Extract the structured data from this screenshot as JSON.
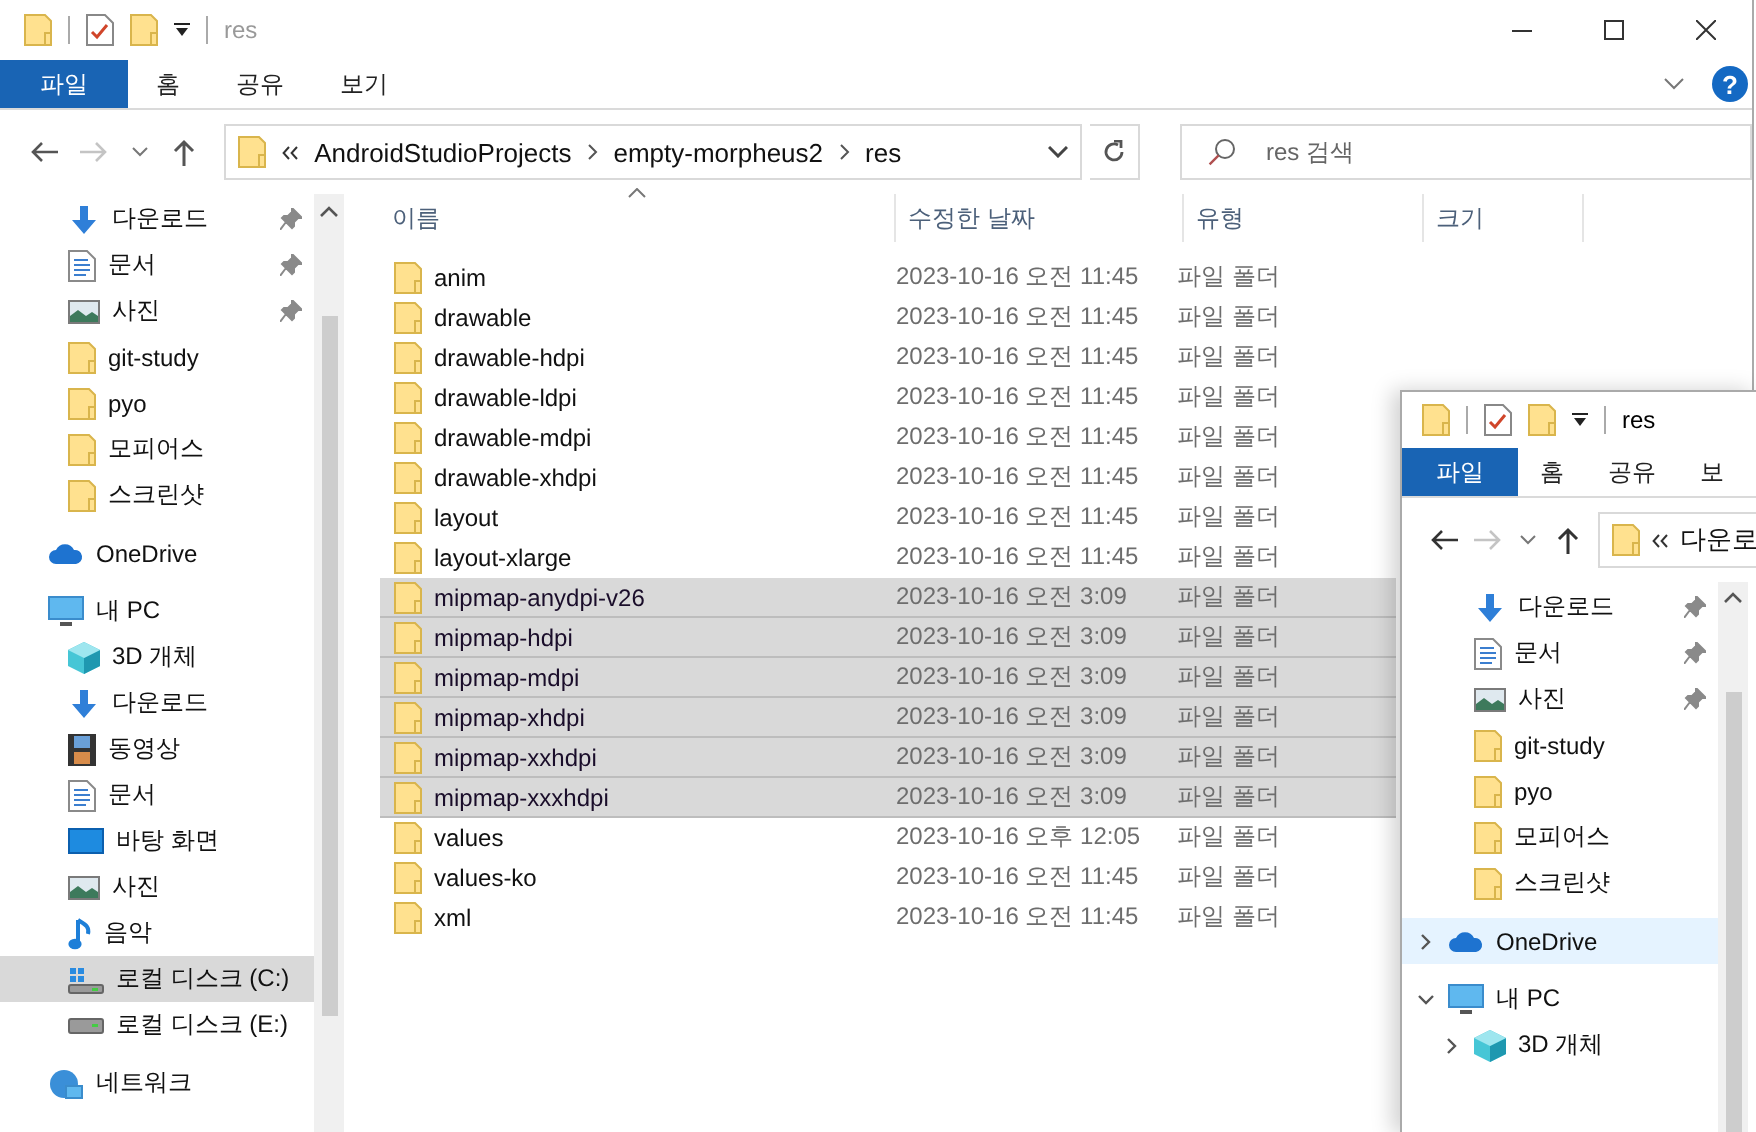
{
  "main_window": {
    "title": "res",
    "active": false,
    "help_glyph": "?",
    "ribbon_tabs": [
      {
        "label": "파일",
        "selected": true
      },
      {
        "label": "홈",
        "selected": false
      },
      {
        "label": "공유",
        "selected": false
      },
      {
        "label": "보기",
        "selected": false
      }
    ],
    "address": {
      "crumbs": [
        "AndroidStudioProjects",
        "empty-morpheus2",
        "res"
      ]
    },
    "search": {
      "placeholder": "res 검색"
    },
    "quick_access": [
      {
        "label": "다운로드",
        "kind": "download",
        "pinned": true,
        "selected": false
      },
      {
        "label": "문서",
        "kind": "document",
        "pinned": true,
        "selected": false
      },
      {
        "label": "사진",
        "kind": "picture",
        "pinned": true,
        "selected": false
      },
      {
        "label": "git-study",
        "kind": "folder",
        "pinned": false,
        "selected": false
      },
      {
        "label": "pyo",
        "kind": "folder",
        "pinned": false,
        "selected": false
      },
      {
        "label": "모피어스",
        "kind": "folder",
        "pinned": false,
        "selected": false
      },
      {
        "label": "스크린샷",
        "kind": "folder",
        "pinned": false,
        "selected": false
      }
    ],
    "tree": [
      {
        "label": "OneDrive",
        "kind": "cloud",
        "selected": false
      },
      {
        "label": "내 PC",
        "kind": "pc",
        "selected": false,
        "children": [
          {
            "label": "3D 개체",
            "kind": "cube",
            "selected": false
          },
          {
            "label": "다운로드",
            "kind": "download",
            "selected": false
          },
          {
            "label": "동영상",
            "kind": "video",
            "selected": false
          },
          {
            "label": "문서",
            "kind": "document",
            "selected": false
          },
          {
            "label": "바탕 화면",
            "kind": "desktop",
            "selected": false
          },
          {
            "label": "사진",
            "kind": "picture",
            "selected": false
          },
          {
            "label": "음악",
            "kind": "music",
            "selected": false
          },
          {
            "label": "로컬 디스크 (C:)",
            "kind": "system-drive",
            "selected": true
          },
          {
            "label": "로컬 디스크 (E:)",
            "kind": "drive",
            "selected": false
          }
        ]
      },
      {
        "label": "네트워크",
        "kind": "network",
        "selected": false
      }
    ],
    "table": {
      "columns": [
        "이름",
        "수정한 날짜",
        "유형",
        "크기"
      ],
      "rows": [
        {
          "name": "anim",
          "modified": "2023-10-16 오전 11:45",
          "type": "파일 폴더",
          "selected": false
        },
        {
          "name": "drawable",
          "modified": "2023-10-16 오전 11:45",
          "type": "파일 폴더",
          "selected": false
        },
        {
          "name": "drawable-hdpi",
          "modified": "2023-10-16 오전 11:45",
          "type": "파일 폴더",
          "selected": false
        },
        {
          "name": "drawable-ldpi",
          "modified": "2023-10-16 오전 11:45",
          "type": "파일 폴더",
          "selected": false
        },
        {
          "name": "drawable-mdpi",
          "modified": "2023-10-16 오전 11:45",
          "type": "파일 폴더",
          "selected": false
        },
        {
          "name": "drawable-xhdpi",
          "modified": "2023-10-16 오전 11:45",
          "type": "파일 폴더",
          "selected": false
        },
        {
          "name": "layout",
          "modified": "2023-10-16 오전 11:45",
          "type": "파일 폴더",
          "selected": false
        },
        {
          "name": "layout-xlarge",
          "modified": "2023-10-16 오전 11:45",
          "type": "파일 폴더",
          "selected": false
        },
        {
          "name": "mipmap-anydpi-v26",
          "modified": "2023-10-16 오전 3:09",
          "type": "파일 폴더",
          "selected": true
        },
        {
          "name": "mipmap-hdpi",
          "modified": "2023-10-16 오전 3:09",
          "type": "파일 폴더",
          "selected": true
        },
        {
          "name": "mipmap-mdpi",
          "modified": "2023-10-16 오전 3:09",
          "type": "파일 폴더",
          "selected": true
        },
        {
          "name": "mipmap-xhdpi",
          "modified": "2023-10-16 오전 3:09",
          "type": "파일 폴더",
          "selected": true
        },
        {
          "name": "mipmap-xxhdpi",
          "modified": "2023-10-16 오전 3:09",
          "type": "파일 폴더",
          "selected": true
        },
        {
          "name": "mipmap-xxxhdpi",
          "modified": "2023-10-16 오전 3:09",
          "type": "파일 폴더",
          "selected": true
        },
        {
          "name": "values",
          "modified": "2023-10-16 오후 12:05",
          "type": "파일 폴더",
          "selected": false
        },
        {
          "name": "values-ko",
          "modified": "2023-10-16 오전 11:45",
          "type": "파일 폴더",
          "selected": false
        },
        {
          "name": "xml",
          "modified": "2023-10-16 오전 11:45",
          "type": "파일 폴더",
          "selected": false
        }
      ]
    }
  },
  "second_window": {
    "title": "res",
    "active": true,
    "ribbon_tabs": [
      {
        "label": "파일",
        "selected": true
      },
      {
        "label": "홈",
        "selected": false
      },
      {
        "label": "공유",
        "selected": false
      },
      {
        "label": "보",
        "selected": false
      }
    ],
    "address": {
      "crumbs": [
        "다운로"
      ]
    },
    "quick_access": [
      {
        "label": "다운로드",
        "kind": "download",
        "pinned": true,
        "selected": false
      },
      {
        "label": "문서",
        "kind": "document",
        "pinned": true,
        "selected": false
      },
      {
        "label": "사진",
        "kind": "picture",
        "pinned": true,
        "selected": false
      },
      {
        "label": "git-study",
        "kind": "folder",
        "pinned": false,
        "selected": false
      },
      {
        "label": "pyo",
        "kind": "folder",
        "pinned": false,
        "selected": false
      },
      {
        "label": "모피어스",
        "kind": "folder",
        "pinned": false,
        "selected": false
      },
      {
        "label": "스크린샷",
        "kind": "folder",
        "pinned": false,
        "selected": false
      }
    ],
    "tree": [
      {
        "label": "OneDrive",
        "kind": "cloud",
        "selected": true,
        "expanded": false
      },
      {
        "label": "내 PC",
        "kind": "pc",
        "selected": false,
        "expanded": true,
        "children": [
          {
            "label": "3D 개체",
            "kind": "cube",
            "selected": false,
            "expanded": false
          }
        ]
      }
    ]
  }
}
